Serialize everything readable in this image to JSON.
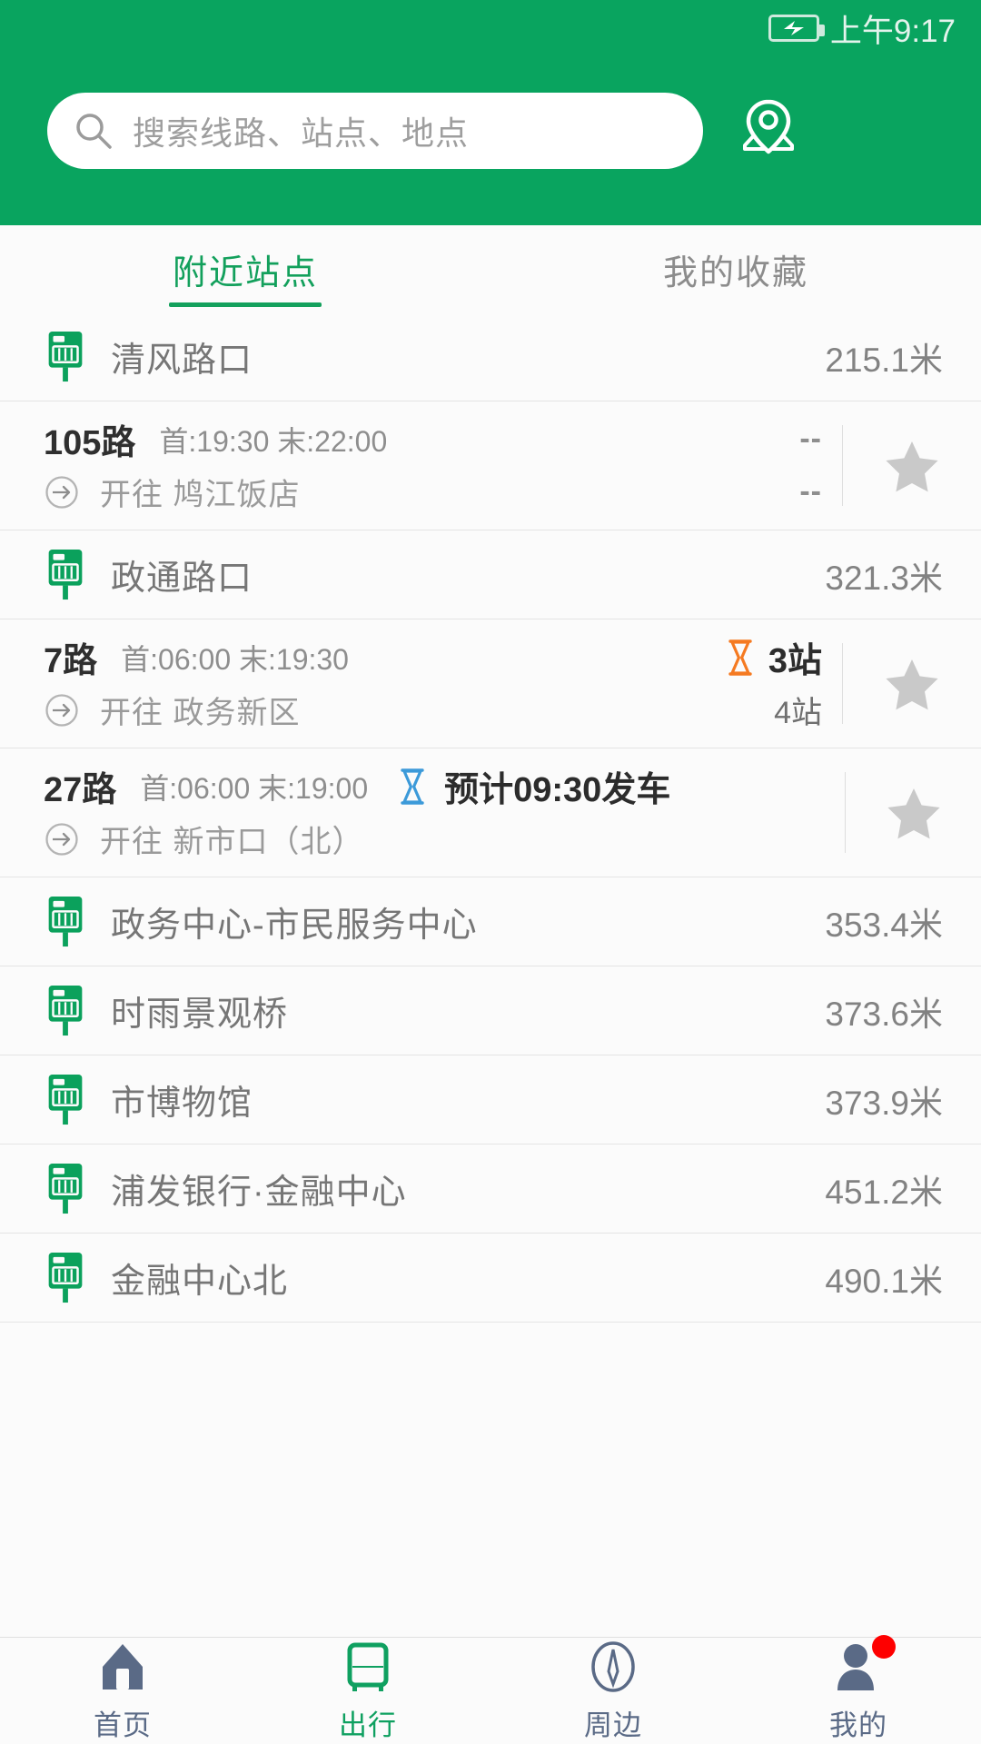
{
  "statusbar": {
    "time": "上午9:17",
    "battery_icon": "battery-charging-icon"
  },
  "search": {
    "placeholder": "搜索线路、站点、地点",
    "icon": "search-icon",
    "map_pin_icon": "map-location-icon"
  },
  "tabs": [
    {
      "label": "附近站点",
      "active": true
    },
    {
      "label": "我的收藏",
      "active": false
    }
  ],
  "colors": {
    "brand_green": "#09a45f",
    "tab_active": "#13a05c",
    "stop_icon": "#0ba15c",
    "hourglass_orange": "#f57a21",
    "hourglass_blue": "#3c9ad9",
    "star_grey": "#c9c9c9",
    "badge_red": "#fe0000",
    "nav_inactive": "#5a6a86"
  },
  "list": [
    {
      "kind": "station",
      "icon": "bus-stop-icon",
      "name": "清风路口",
      "distance": "215.1米"
    },
    {
      "kind": "route",
      "number": "105路",
      "times": "首:19:30  末:22:00",
      "direction_prefix": "开往",
      "direction": "鸠江饭店",
      "direction_icon": "arrow-right-circle-icon",
      "eta_style": "stacked",
      "eta_primary": "--",
      "eta_secondary": "--",
      "eta_icon": null,
      "favorite_icon": "star-icon",
      "favorited": false
    },
    {
      "kind": "station",
      "icon": "bus-stop-icon",
      "name": "政通路口",
      "distance": "321.3米"
    },
    {
      "kind": "route",
      "number": "7路",
      "times": "首:06:00  末:19:30",
      "direction_prefix": "开往",
      "direction": "政务新区",
      "direction_icon": "arrow-right-circle-icon",
      "eta_style": "stacked",
      "eta_primary": "3站",
      "eta_secondary": "4站",
      "eta_icon": "hourglass-orange-icon",
      "favorite_icon": "star-icon",
      "favorited": false
    },
    {
      "kind": "route",
      "number": "27路",
      "times": "首:06:00  末:19:00",
      "direction_prefix": "开往",
      "direction": "新市口（北）",
      "direction_icon": "arrow-right-circle-icon",
      "eta_style": "inline",
      "eta_primary": "预计09:30发车",
      "eta_secondary": "",
      "eta_icon": "hourglass-blue-icon",
      "favorite_icon": "star-icon",
      "favorited": false
    },
    {
      "kind": "station",
      "icon": "bus-stop-icon",
      "name": "政务中心-市民服务中心",
      "distance": "353.4米"
    },
    {
      "kind": "station",
      "icon": "bus-stop-icon",
      "name": "时雨景观桥",
      "distance": "373.6米"
    },
    {
      "kind": "station",
      "icon": "bus-stop-icon",
      "name": "市博物馆",
      "distance": "373.9米"
    },
    {
      "kind": "station",
      "icon": "bus-stop-icon",
      "name": "浦发银行·金融中心",
      "distance": "451.2米"
    },
    {
      "kind": "station",
      "icon": "bus-stop-icon",
      "name": "金融中心北",
      "distance": "490.1米"
    }
  ],
  "bottom_nav": [
    {
      "label": "首页",
      "icon": "home-icon",
      "active": false,
      "badge": false
    },
    {
      "label": "出行",
      "icon": "bus-icon",
      "active": true,
      "badge": false
    },
    {
      "label": "周边",
      "icon": "compass-icon",
      "active": false,
      "badge": false
    },
    {
      "label": "我的",
      "icon": "user-icon",
      "active": false,
      "badge": true
    }
  ]
}
